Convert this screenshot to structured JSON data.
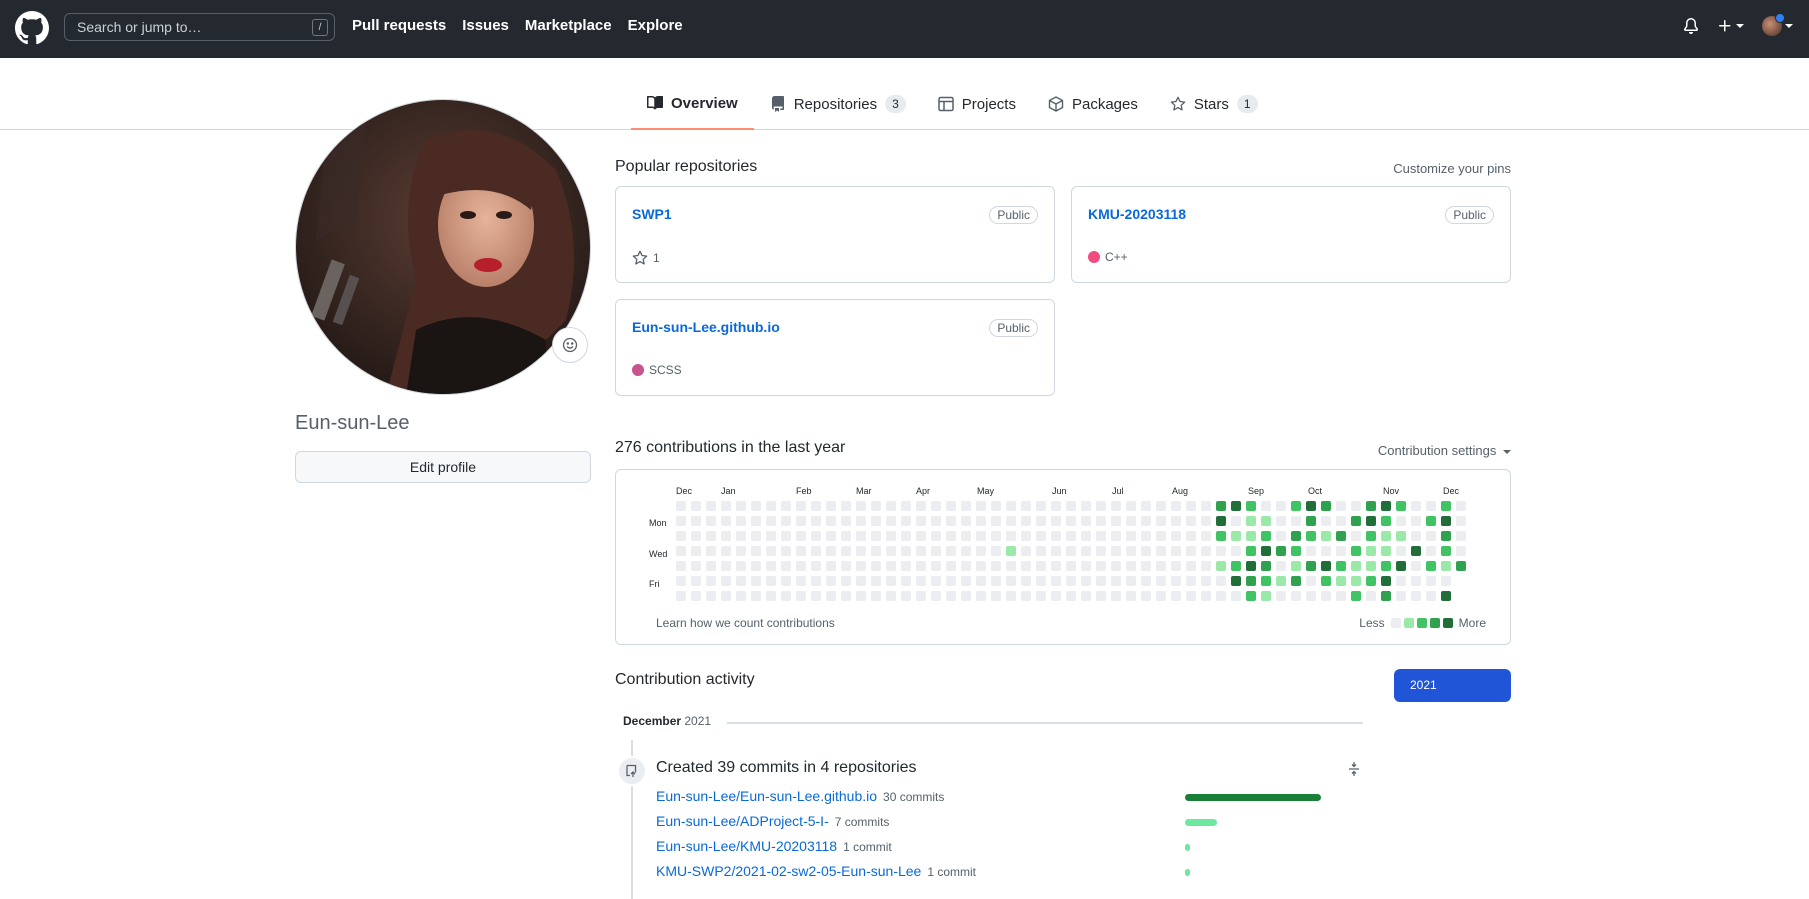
{
  "header": {
    "search_placeholder": "Search or jump to…",
    "search_shortcut": "/",
    "nav": [
      "Pull requests",
      "Issues",
      "Marketplace",
      "Explore"
    ]
  },
  "tabs": [
    {
      "label": "Overview",
      "count": ""
    },
    {
      "label": "Repositories",
      "count": "3"
    },
    {
      "label": "Projects",
      "count": ""
    },
    {
      "label": "Packages",
      "count": ""
    },
    {
      "label": "Stars",
      "count": "1"
    }
  ],
  "profile": {
    "username": "Eun-sun-Lee",
    "edit_label": "Edit profile"
  },
  "popular": {
    "title": "Popular repositories",
    "customize": "Customize your pins",
    "repos": [
      {
        "name": "SWP1",
        "visibility": "Public",
        "meta": "1",
        "meta_type": "star"
      },
      {
        "name": "KMU-20203118",
        "visibility": "Public",
        "meta": "C++",
        "meta_type": "lang",
        "color": "#f34b7d"
      },
      {
        "name": "Eun-sun-Lee.github.io",
        "visibility": "Public",
        "meta": "SCSS",
        "meta_type": "lang",
        "color": "#c6538c"
      }
    ]
  },
  "contributions": {
    "title": "276 contributions in the last year",
    "settings": "Contribution settings",
    "months": [
      "Dec",
      "Jan",
      "Feb",
      "Mar",
      "Apr",
      "May",
      "Jun",
      "Jul",
      "Aug",
      "Sep",
      "Oct",
      "Nov",
      "Dec"
    ],
    "weekdays": [
      "Mon",
      "Wed",
      "Fri"
    ],
    "learn": "Learn how we count contributions",
    "less": "Less",
    "more": "More",
    "levels": [
      "#ebedf0",
      "#9be9a8",
      "#40c463",
      "#30a14e",
      "#216e39"
    ]
  },
  "activity": {
    "title": "Contribution activity",
    "year": "2021",
    "month": "December",
    "month_year": "2021",
    "summary": "Created 39 commits in 4 repositories",
    "repos": [
      {
        "name": "Eun-sun-Lee/Eun-sun-Lee.github.io",
        "count": "30 commits",
        "commits": 30
      },
      {
        "name": "Eun-sun-Lee/ADProject-5-I-",
        "count": "7 commits",
        "commits": 7
      },
      {
        "name": "Eun-sun-Lee/KMU-20203118",
        "count": "1 commit",
        "commits": 1
      },
      {
        "name": "KMU-SWP2/2021-02-sw2-05-Eun-sun-Lee",
        "count": "1 commit",
        "commits": 1
      }
    ]
  }
}
